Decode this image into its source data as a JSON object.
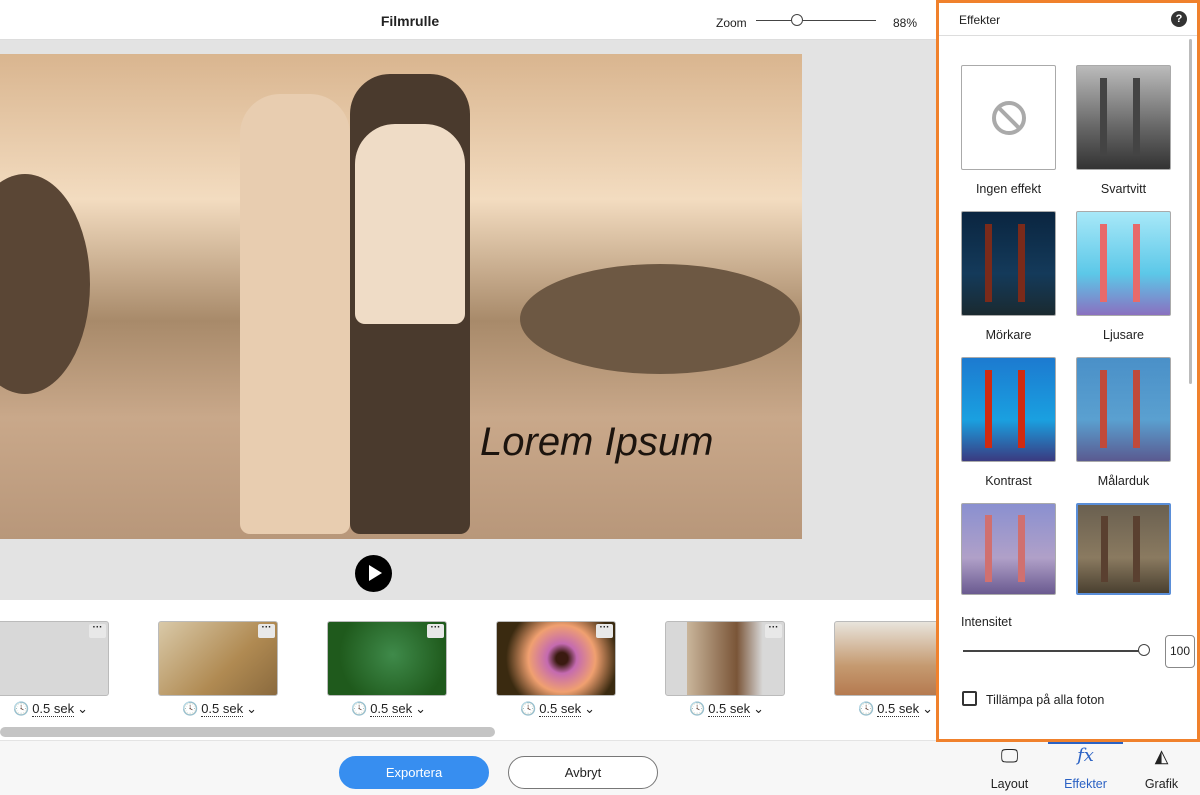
{
  "header": {
    "title": "Filmrulle",
    "zoom_label": "Zoom",
    "zoom_value": "88%",
    "zoom_fraction": 0.35
  },
  "preview": {
    "caption": "Lorem Ipsum"
  },
  "clips": [
    {
      "duration": "0.5 sek"
    },
    {
      "duration": "0.5 sek"
    },
    {
      "duration": "0.5 sek"
    },
    {
      "duration": "0.5 sek"
    },
    {
      "duration": "0.5 sek"
    },
    {
      "duration": "0.5 sek"
    }
  ],
  "actions": {
    "export": "Exportera",
    "cancel": "Avbryt"
  },
  "panel": {
    "title": "Effekter",
    "help": "?",
    "effects": [
      {
        "label": "Ingen effekt"
      },
      {
        "label": "Svartvitt"
      },
      {
        "label": "Mörkare"
      },
      {
        "label": "Ljusare"
      },
      {
        "label": "Kontrast"
      },
      {
        "label": "Målarduk"
      },
      {
        "label": ""
      },
      {
        "label": ""
      }
    ],
    "selected_effect_index": 7,
    "intensity_label": "Intensitet",
    "intensity_value": "100",
    "apply_all_label": "Tillämpa på alla foton",
    "apply_all_checked": false
  },
  "tabs": [
    {
      "label": "Layout"
    },
    {
      "label": "Effekter",
      "active": true
    },
    {
      "label": "Grafik"
    }
  ],
  "colors": {
    "accent": "#378ef0",
    "panel_border": "#f0812c",
    "active_tab": "#2b62c4"
  }
}
